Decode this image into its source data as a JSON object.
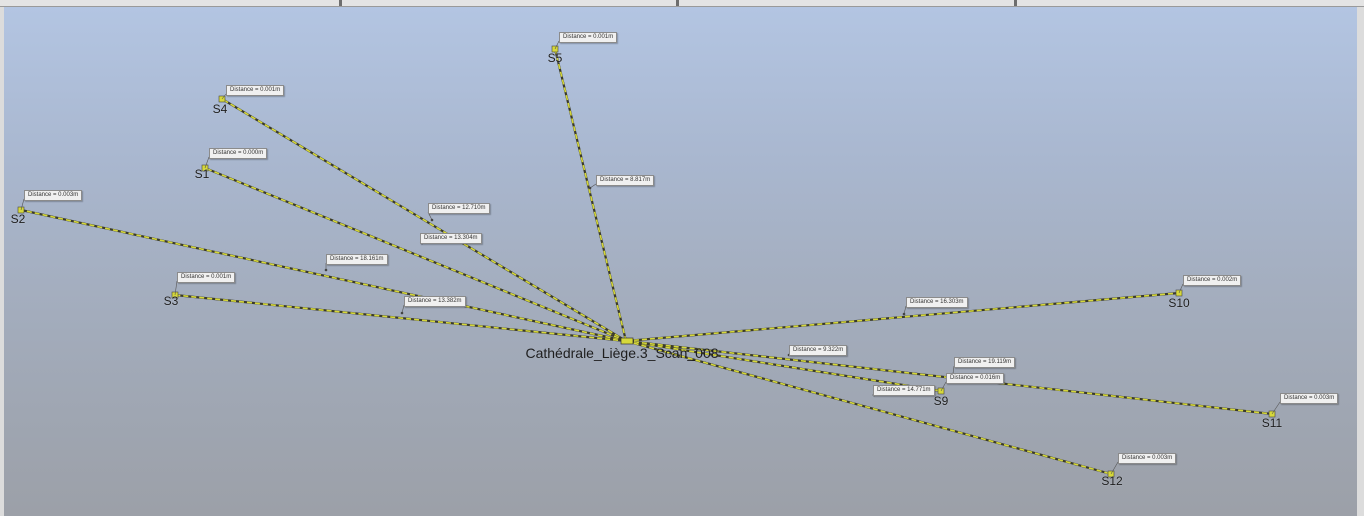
{
  "center": {
    "name": "Cathédrale_Liège.3_Scan_008"
  },
  "stations": [
    {
      "id": "s5",
      "name": "S5",
      "target_distance": "Distance = 0.001m",
      "line_distance": "Distance = 8.817m"
    },
    {
      "id": "s4",
      "name": "S4",
      "target_distance": "Distance = 0.001m",
      "line_distance": "Distance = 12.710m"
    },
    {
      "id": "s1",
      "name": "S1",
      "target_distance": "Distance = 0.000m",
      "line_distance": "Distance = 13.304m"
    },
    {
      "id": "s2",
      "name": "S2",
      "target_distance": "Distance = 0.003m",
      "line_distance": "Distance = 18.161m"
    },
    {
      "id": "s3",
      "name": "S3",
      "target_distance": "Distance = 0.001m",
      "line_distance": "Distance = 13.382m"
    },
    {
      "id": "s10",
      "name": "S10",
      "target_distance": "Distance = 0.002m",
      "line_distance": "Distance = 16.303m"
    },
    {
      "id": "s9",
      "name": "S9",
      "target_distance": "Distance = 0.016m",
      "line_distance": "Distance = 9.322m"
    },
    {
      "id": "s11",
      "name": "S11",
      "target_distance": "Distance = 0.003m",
      "line_distance": "Distance = 19.119m"
    },
    {
      "id": "s12",
      "name": "S12",
      "target_distance": "Distance = 0.003m",
      "line_distance": "Distance = 14.771m"
    }
  ],
  "colors": {
    "line_yellow": "#d6d83a",
    "line_dark": "#3a3a2a",
    "background_top": "#b3c5e2",
    "background_bottom": "#9ca0a8"
  }
}
